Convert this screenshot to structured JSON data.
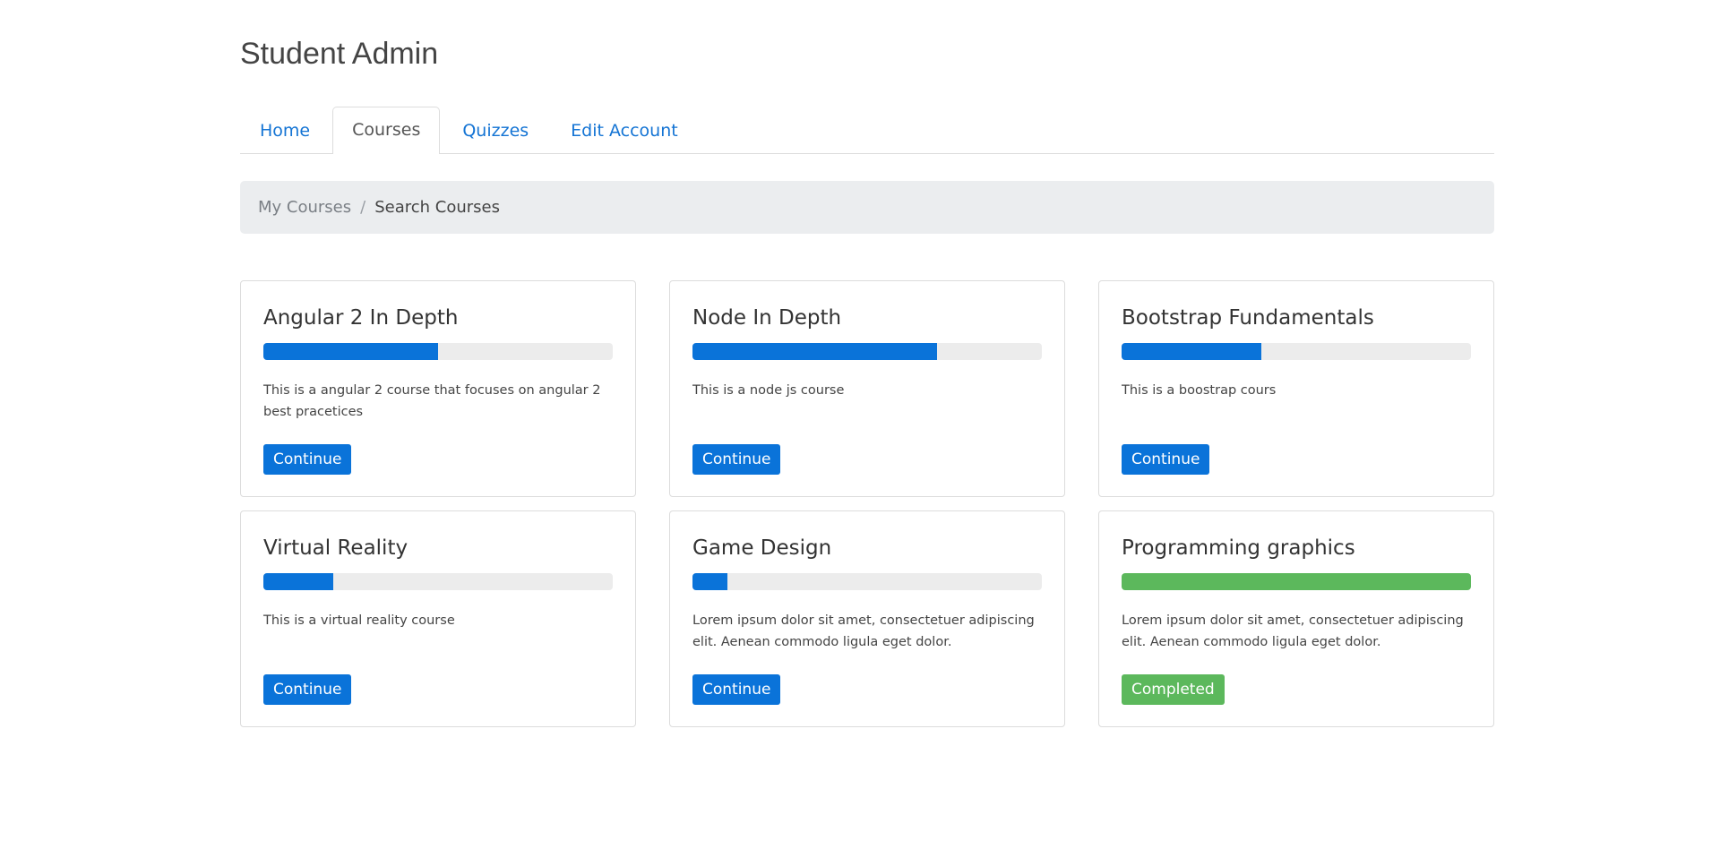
{
  "app": {
    "title": "Student Admin"
  },
  "nav": {
    "tabs": [
      {
        "label": "Home",
        "active": false
      },
      {
        "label": "Courses",
        "active": true
      },
      {
        "label": "Quizzes",
        "active": false
      },
      {
        "label": "Edit Account",
        "active": false
      }
    ]
  },
  "breadcrumb": {
    "link": "My Courses",
    "separator": "/",
    "current": "Search Courses"
  },
  "colors": {
    "primary": "#0a73d9",
    "success": "#5cb85c",
    "progress_track": "#ececec",
    "breadcrumb_bg": "#ebedef"
  },
  "courses": [
    {
      "title": "Angular 2 In Depth",
      "progress": 0.5,
      "description": "This is a angular 2 course that focuses on angular 2 best pracetices",
      "button": "Continue",
      "status": "in-progress"
    },
    {
      "title": "Node In Depth",
      "progress": 0.7,
      "description": "This is a node js course",
      "button": "Continue",
      "status": "in-progress"
    },
    {
      "title": "Bootstrap Fundamentals",
      "progress": 0.4,
      "description": "This is a boostrap cours",
      "button": "Continue",
      "status": "in-progress"
    },
    {
      "title": "Virtual Reality",
      "progress": 0.2,
      "description": "This is a virtual reality course",
      "button": "Continue",
      "status": "in-progress"
    },
    {
      "title": "Game Design",
      "progress": 0.1,
      "description": "Lorem ipsum dolor sit amet, consectetuer adipiscing elit. Aenean commodo ligula eget dolor.",
      "button": "Continue",
      "status": "in-progress"
    },
    {
      "title": "Programming graphics",
      "progress": 1.0,
      "description": "Lorem ipsum dolor sit amet, consectetuer adipiscing elit. Aenean commodo ligula eget dolor.",
      "button": "Completed",
      "status": "completed"
    }
  ]
}
